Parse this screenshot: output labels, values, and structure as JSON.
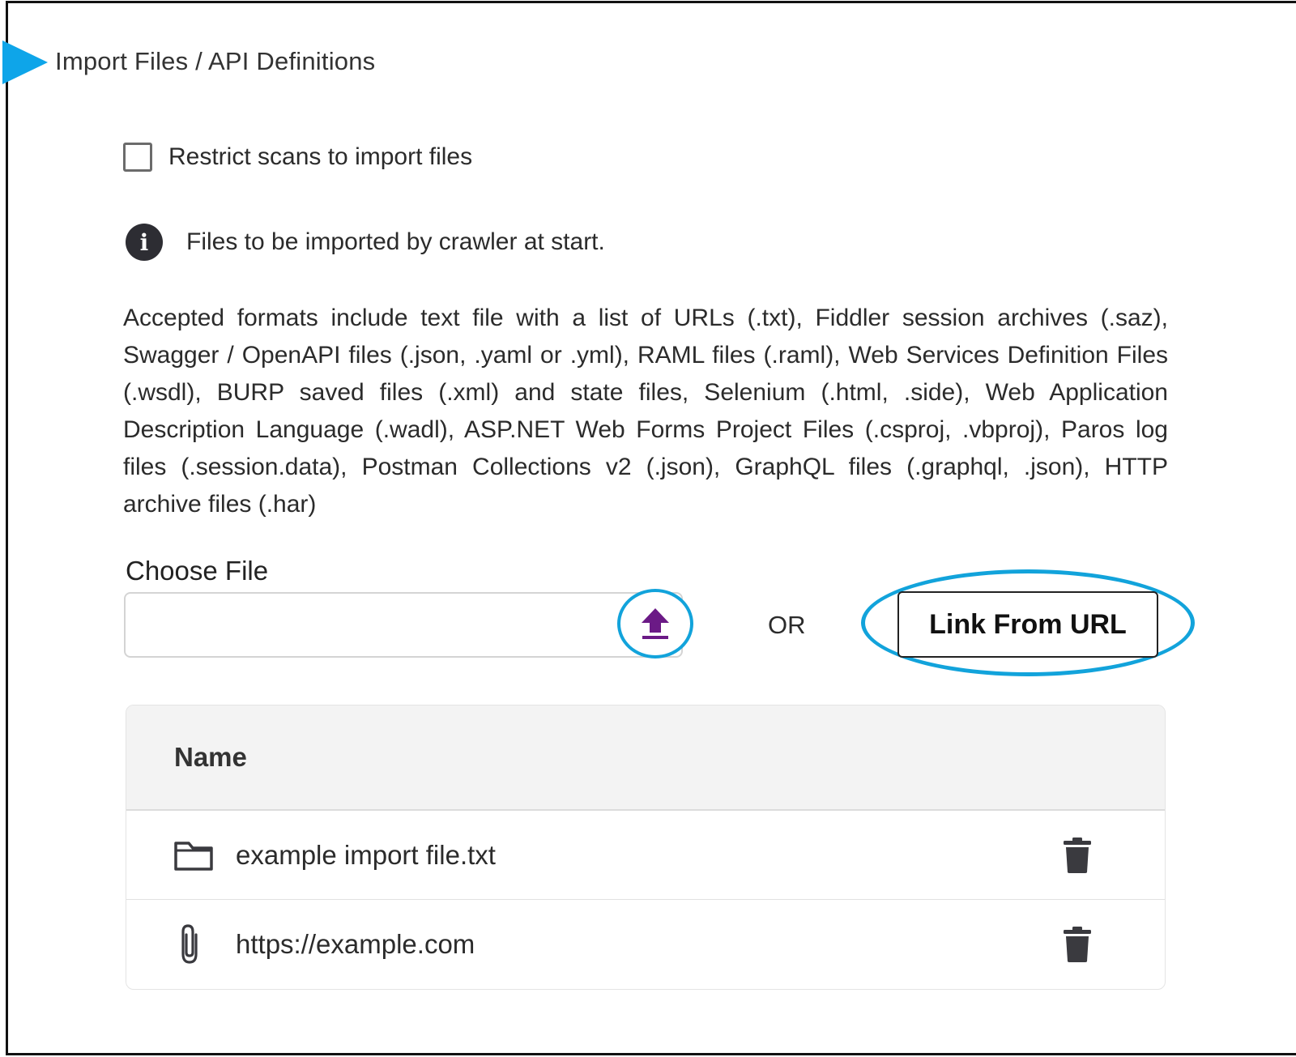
{
  "section": {
    "title": "Import Files / API Definitions"
  },
  "restrict": {
    "label": "Restrict scans to import files",
    "checked": false
  },
  "info": {
    "icon": "info-icon",
    "text": "Files to be imported by crawler at start."
  },
  "formats_text": "Accepted formats include text file with a list of URLs (.txt), Fiddler session archives (.saz), Swagger / OpenAPI files (.json, .yaml or .yml), RAML files (.raml), Web Services Definition Files (.wsdl), BURP saved files (.xml) and state files, Selenium (.html, .side), Web Application Description Language (.wadl), ASP.NET Web Forms Project Files (.csproj, .vbproj), Paros log files (.session.data), Postman Collections v2 (.json), GraphQL files (.graphql, .json), HTTP archive files (.har)",
  "choose_file": {
    "label": "Choose File",
    "value": "",
    "upload_icon": "upload-icon"
  },
  "or_label": "OR",
  "link_button": {
    "label": "Link From URL"
  },
  "table": {
    "header": "Name",
    "rows": [
      {
        "icon": "folder-icon",
        "name": "example import file.txt"
      },
      {
        "icon": "paperclip-icon",
        "name": "https://example.com"
      }
    ]
  },
  "colors": {
    "accent_blue": "#12a3db",
    "upload_purple": "#6b1a86",
    "marker_blue": "#0ea5e9",
    "dark_icon": "#3a3a3f"
  }
}
